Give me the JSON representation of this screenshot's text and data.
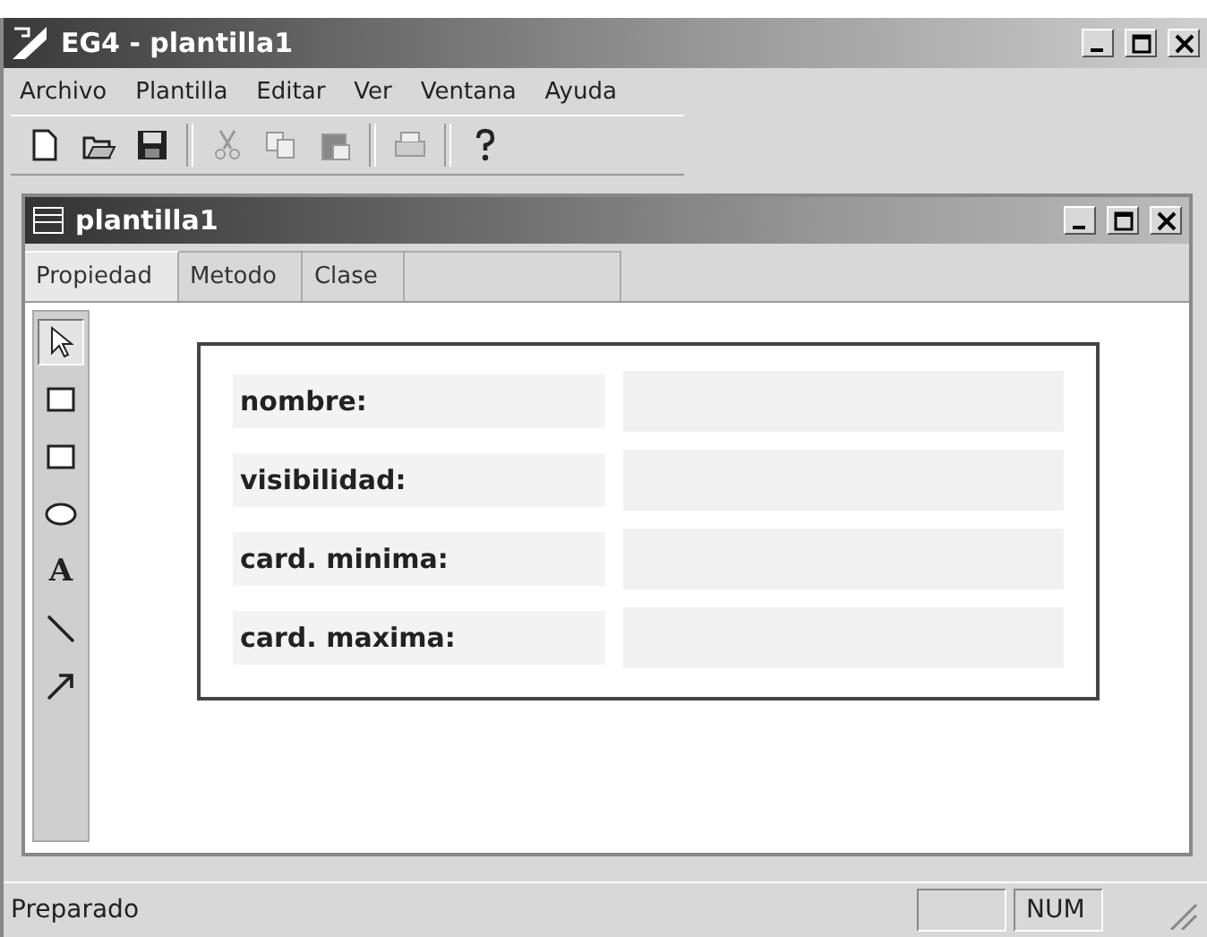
{
  "window": {
    "title": "EG4 - plantilla1"
  },
  "menu": [
    "Archivo",
    "Plantilla",
    "Editar",
    "Ver",
    "Ventana",
    "Ayuda"
  ],
  "toolbar": [
    {
      "kind": "new",
      "disabled": false
    },
    {
      "kind": "open",
      "disabled": false
    },
    {
      "kind": "save",
      "disabled": false
    },
    {
      "kind": "sep"
    },
    {
      "kind": "cut",
      "disabled": true
    },
    {
      "kind": "copy",
      "disabled": true
    },
    {
      "kind": "paste",
      "disabled": true
    },
    {
      "kind": "sep"
    },
    {
      "kind": "print",
      "disabled": true
    },
    {
      "kind": "sep"
    },
    {
      "kind": "help",
      "disabled": false
    }
  ],
  "document": {
    "title": "plantilla1",
    "tabs": [
      {
        "label": "Propiedad",
        "selected": true
      },
      {
        "label": "Metodo",
        "selected": false
      },
      {
        "label": "Clase",
        "selected": false
      }
    ],
    "tools": [
      {
        "kind": "pointer",
        "selected": true
      },
      {
        "kind": "rectangle",
        "selected": false
      },
      {
        "kind": "rectangle",
        "selected": false
      },
      {
        "kind": "ellipse",
        "selected": false
      },
      {
        "kind": "text",
        "label": "A",
        "selected": false
      },
      {
        "kind": "line",
        "selected": false
      },
      {
        "kind": "arrow",
        "selected": false
      }
    ],
    "fields": [
      {
        "label": "nombre:"
      },
      {
        "label": "visibilidad:"
      },
      {
        "label": "card. minima:"
      },
      {
        "label": "card. maxima:"
      }
    ]
  },
  "status_bar": {
    "message": "Preparado",
    "num_lock": "NUM"
  }
}
